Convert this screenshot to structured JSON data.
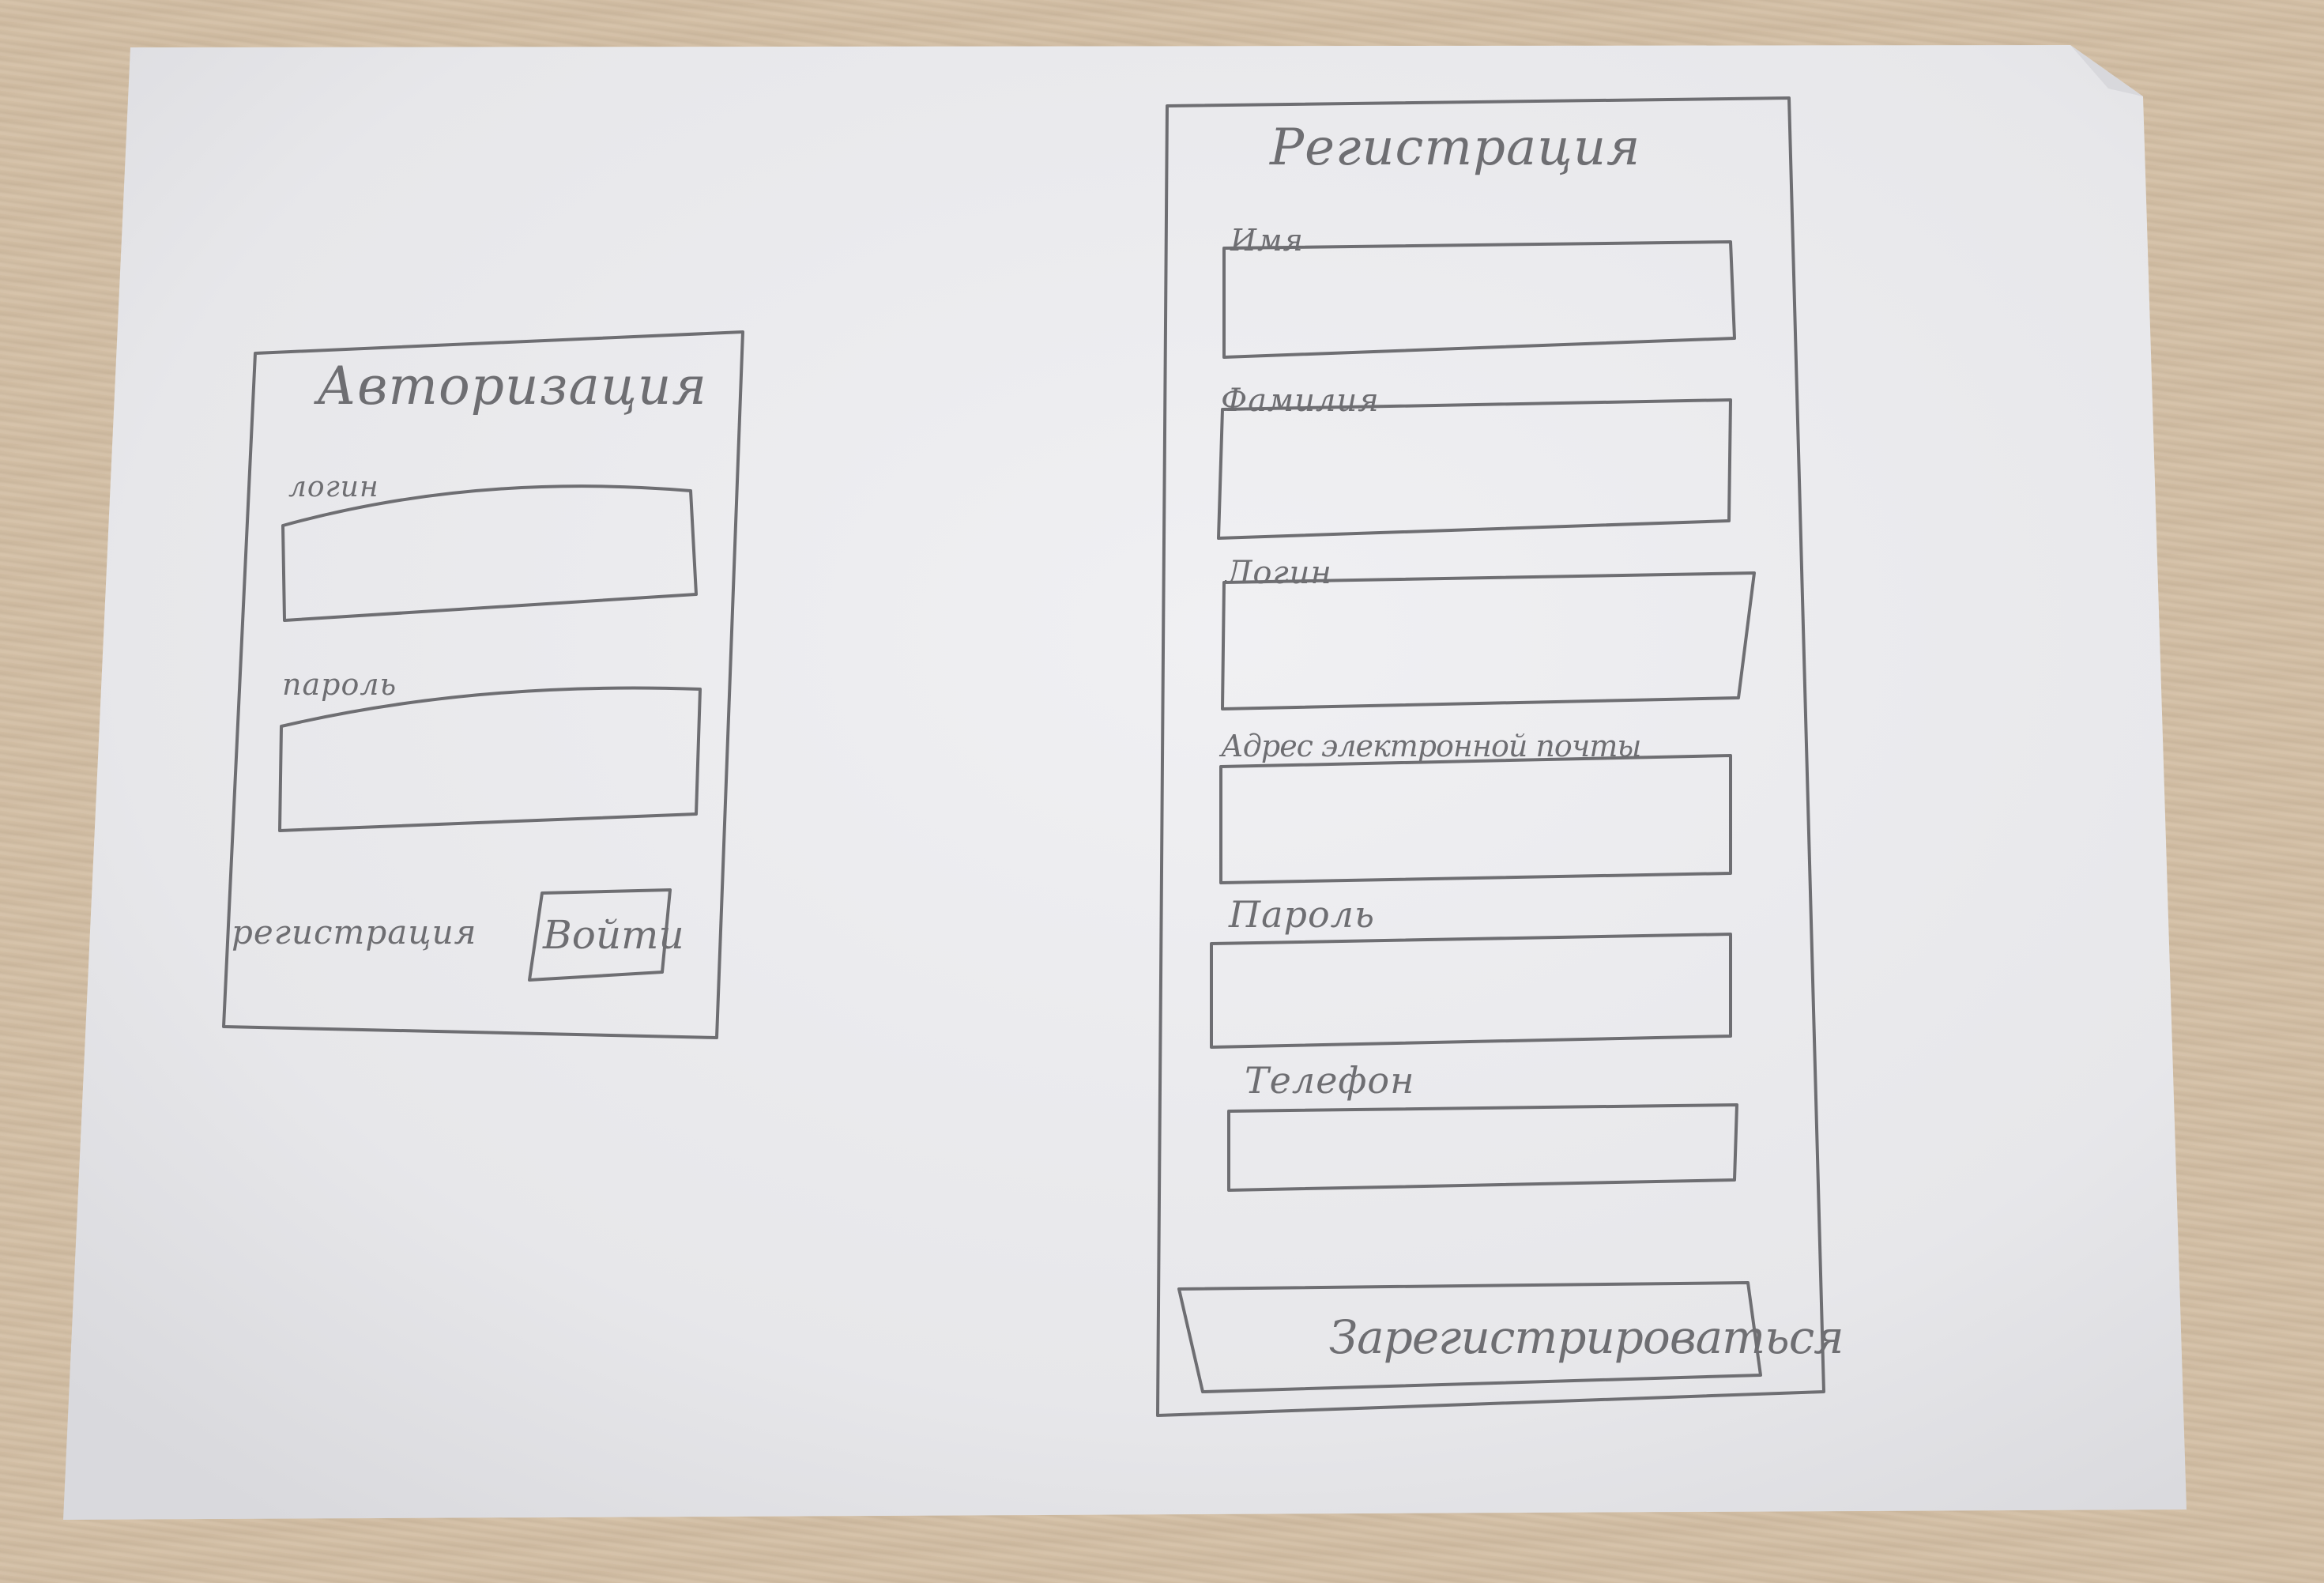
{
  "login_form": {
    "title": "Авторизация",
    "login_label": "логин",
    "password_label": "пароль",
    "register_link": "регистрация",
    "submit_button": "Войти"
  },
  "registration_form": {
    "title": "Регистрация",
    "fields": [
      {
        "label": "Имя"
      },
      {
        "label": "Фамилия"
      },
      {
        "label": "Логин"
      },
      {
        "label": "Адрес электронной почты"
      },
      {
        "label": "Пароль"
      },
      {
        "label": "Телефон"
      }
    ],
    "submit_button": "Зарегистрироваться"
  },
  "colors": {
    "paper": "#ebebee",
    "pencil": "#6e6e72",
    "wood": "#d4c0a6"
  }
}
